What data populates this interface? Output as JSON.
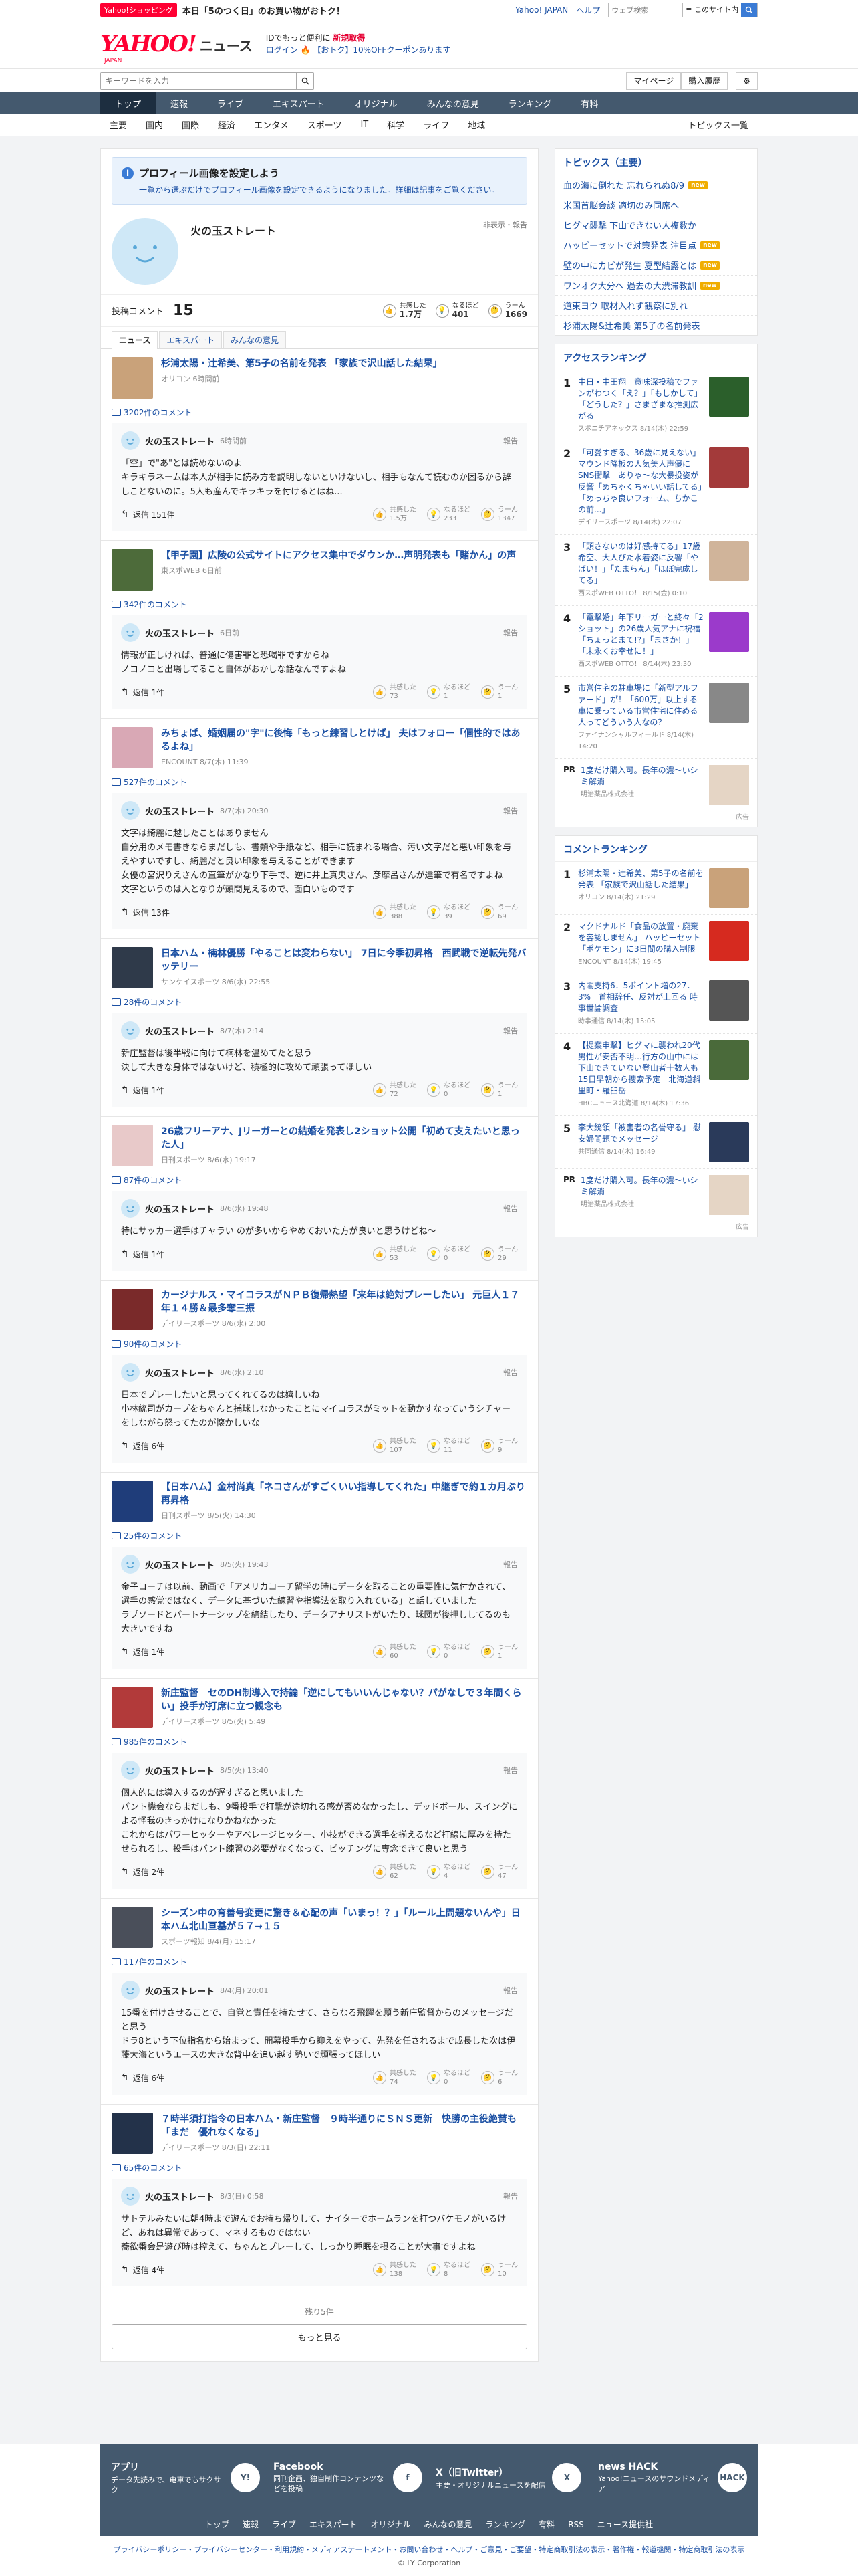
{
  "promo": {
    "shop": "Yahoo!ショッピング",
    "text": "本日「5のつく日」のお買い物がおトク！",
    "links": [
      "Yahoo! JAPAN",
      "ヘルプ"
    ],
    "search_placeholder": "ウェブ検索",
    "search_scope": "≡ このサイト内"
  },
  "header": {
    "logo": "YAHOO!",
    "logo_jp": "JAPAN",
    "logo_news": "ニュース",
    "msg1": "IDでもっと便利に",
    "msg1b": "新規取得",
    "login": "ログイン",
    "msg2": "【おトク】10%OFFクーポンあります"
  },
  "search": {
    "placeholder": "キーワードを入力",
    "mypage": "マイページ",
    "history": "購入履歴"
  },
  "nav": [
    "トップ",
    "速報",
    "ライブ",
    "エキスパート",
    "オリジナル",
    "みんなの意見",
    "ランキング",
    "有料"
  ],
  "subnav": [
    "主要",
    "国内",
    "国際",
    "経済",
    "エンタメ",
    "スポーツ",
    "IT",
    "科学",
    "ライフ",
    "地域"
  ],
  "subnav_right": "トピックス一覧",
  "notice": {
    "title": "プロフィール画像を設定しよう",
    "desc": "一覧から選ぶだけでプロフィール画像を設定できるようになりました。詳細は記事をご覧ください。"
  },
  "profile": {
    "name": "火の玉ストレート",
    "report": "非表示・報告"
  },
  "stats": {
    "label": "投稿コメント",
    "count": "15",
    "items": [
      {
        "l": "共感した",
        "v": "1.7万"
      },
      {
        "l": "なるほど",
        "v": "401"
      },
      {
        "l": "うーん",
        "v": "1669"
      }
    ]
  },
  "tabs": [
    "ニュース",
    "エキスパート",
    "みんなの意見"
  ],
  "items": [
    {
      "title": "杉浦太陽・辻希美、第5子の名前を発表 「家族で沢山話した結果」",
      "src": "オリコン 6時間前",
      "count": "3202件のコメント",
      "time": "6時間前",
      "body": "「空」で\"あ\"とは読めないのよ\nキラキラネームは本人が相手に読み方を説明しないといけないし、相手もなんて読むのか困るから辞しことないのに。5人も産んでキラキラを付けるとはね...",
      "reply": "返信 151件",
      "r": [
        "1.5万",
        "233",
        "1347"
      ],
      "col": "#c9a27a"
    },
    {
      "title": "【甲子園】広陵の公式サイトにアクセス集中でダウンか…声明発表も「賭かん」の声",
      "src": "東スポWEB 6日前",
      "count": "342件のコメント",
      "time": "6日前",
      "body": "情報が正しければ、普通に傷害罪と恐喝罪ですからね\nノコノコと出場してること自体がおかしな話なんですよね",
      "reply": "返信 1件",
      "r": [
        "73",
        "1",
        "1"
      ],
      "col": "#4d6b3a"
    },
    {
      "title": "みちょぱ、婚姻届の\"字\"に後悔「もっと練習しとけば」 夫はフォロー「個性的ではあるよね」",
      "src": "ENCOUNT 8/7(木) 11:39",
      "count": "527件のコメント",
      "time": "8/7(木) 20:30",
      "body": "文字は綺麗に越したことはありません\n自分用のメモ書きならまだしも、書類や手紙など、相手に読まれる場合、汚い文字だと悪い印象を与えやすいですし、綺麗だと良い印象を与えることができます\n女優の宮沢りえさんの直筆がかなり下手で、逆に井上真央さん、彦摩呂さんが達筆で有名ですよね\n文字というのは人となりが頭間見えるので、面白いものです",
      "reply": "返信 13件",
      "r": [
        "388",
        "39",
        "69"
      ],
      "col": "#d9a8b5"
    },
    {
      "title": "日本ハム・楠林優勝「やることは変わらない」 7日に今季初昇格　西武戦で逆転先発バッテリー",
      "src": "サンケイスポーツ 8/6(水) 22:55",
      "count": "28件のコメント",
      "time": "8/7(木) 2:14",
      "body": "新庄監督は後半戦に向けて楠林を温めてたと思う\n決して大きな身体ではないけど、積極的に攻めて頑張ってほしい",
      "reply": "返信 1件",
      "r": [
        "72",
        "0",
        "1"
      ],
      "col": "#2f3a4a"
    },
    {
      "title": "26歳フリーアナ、Jリーガーとの結婚を発表し2ショット公開「初めて支えたいと思った人」",
      "src": "日刊スポーツ 8/6(水) 19:17",
      "count": "87件のコメント",
      "time": "8/6(水) 19:48",
      "body": "特にサッカー選手はチャラい のが多いからやめておいた方が良いと思うけどね〜",
      "reply": "返信 1件",
      "r": [
        "53",
        "0",
        "29"
      ],
      "col": "#e8c9c9"
    },
    {
      "title": "カージナルス・マイコラスがＮＰＢ復帰熱望「来年は絶対プレーしたい」 元巨人１７年１４勝＆最多奪三振",
      "src": "デイリースポーツ 8/6(水) 2:00",
      "count": "90件のコメント",
      "time": "8/6(水) 2:10",
      "body": "日本でプレーしたいと思ってくれてるのは嬉しいね\n小林統司がカープをちゃんと捕球しなかったことにマイコラスがミットを動かすなっていうシチャーをしながら怒ってたのが懐かしいな",
      "reply": "返信 6件",
      "r": [
        "107",
        "11",
        "9"
      ],
      "col": "#7a2a2a"
    },
    {
      "title": "【日本ハム】金村尚真「ネコさんがすごくいい指導してくれた」中継ぎで約１カ月ぶり再昇格",
      "src": "日刊スポーツ 8/5(火) 14:30",
      "count": "25件のコメント",
      "time": "8/5(火) 19:43",
      "body": "金子コーチは以前、動画で「アメリカコーチ留学の時にデータを取ることの重要性に気付かされて、選手の感覚ではなく、データに基づいた練習や指導法を取り入れている」と話していました\nラプソードとパートナーシップを締結したり、データアナリストがいたり、球団が後押ししてるのも大きいですね",
      "reply": "返信 1件",
      "r": [
        "60",
        "0",
        "1"
      ],
      "col": "#1f3d7a"
    },
    {
      "title": "新庄監督　セのDH制導入で持論「逆にしてもいいんじゃない？パがなしで３年間くらい」投手が打席に立つ観念も",
      "src": "デイリースポーツ 8/5(火) 5:49",
      "count": "985件のコメント",
      "time": "8/5(火) 13:40",
      "body": "個人的には導入するのが遅すぎると思いました\nパント機会ならまだしも、9番投手で打撃が途切れる感が否めなかったし、デッドボール、スイングによる怪我のきっかけになりかねなかった\nこれからはパワーヒッターやアベレージヒッター、小技ができる選手を揃えるなど打線に厚みを持たせられるし、投手はバント練習の必要がなくなって、ピッチングに専念できて良いと思う",
      "reply": "返信 2件",
      "r": [
        "62",
        "4",
        "47"
      ],
      "col": "#b23a3a"
    },
    {
      "title": "シーズン中の育善号変更に驚き＆心配の声「いまっ！？」「ルール上問題ないんや」日本ハム北山亘基が５７→１５",
      "src": "スポーツ報知 8/4(月) 15:17",
      "count": "117件のコメント",
      "time": "8/4(月) 20:01",
      "body": "15番を付けさせることで、自覚と責任を持たせて、さらなる飛躍を願う新庄監督からのメッセージだと思う\nドラ8という下位指名から始まって、開幕投手から抑えをやって、先発を任されるまで成長した次は伊藤大海というエースの大きな背中を追い越す勢いで頑張ってほしい",
      "reply": "返信 6件",
      "r": [
        "74",
        "0",
        "6"
      ],
      "col": "#4a4f5a"
    },
    {
      "title": "７時半須打指令の日本ハム・新庄監督　９時半通りにＳＮＳ更新　快勝の主役絶賛も「まだ　優れなくなる」",
      "src": "デイリースポーツ 8/3(日) 22:11",
      "count": "65件のコメント",
      "time": "8/3(日) 0:58",
      "body": "サトテルみたいに朝4時まで遊んでお持ち帰りして、ナイターでホームランを打つバケモノがいるけど、あれは異常であって、マネするものではない\n蕎欲番会是遊び時は控えて、ちゃんとプレーして、しっかり睡眠を摂ることが大事ですよね",
      "reply": "返信 4件",
      "r": [
        "138",
        "8",
        "10"
      ],
      "col": "#23324a"
    }
  ],
  "more": {
    "remaining": "残り5件",
    "button": "もっと見る"
  },
  "side": {
    "topics_title": "トピックス（主要）",
    "topics": [
      {
        "t": "血の海に倒れた 忘れられぬ8/9",
        "b": "new"
      },
      {
        "t": "米国首脳会談 適切のみ同席へ",
        "b": ""
      },
      {
        "t": "ヒグマ襲撃 下山できない人複数か",
        "b": ""
      },
      {
        "t": "ハッピーセットで対策発表 注目点",
        "b": "new"
      },
      {
        "t": "壁の中にカビが発生 夏型結露とは",
        "b": "new"
      },
      {
        "t": "ワンオク大分へ 過去の大渋滞教訓",
        "b": "new"
      },
      {
        "t": "道東ヨウ 取材入れず観察に別れ",
        "b": ""
      },
      {
        "t": "杉浦太陽&辻希美 第5子の名前発表",
        "b": ""
      }
    ],
    "access_title": "アクセスランキング",
    "access": [
      {
        "t": "中日・中田翔　意味深投稿でファンがわつく「え？」「もしかして」「どうした？」さまざまな推測広がる",
        "s": "スポニチアネックス 8/14(木) 22:59",
        "c": "#2b5f2b"
      },
      {
        "t": "「可愛すぎる、36歳に見えない」マウンド降板の人気美人声優にSNS衝撃　ありゃ〜な大暴投姿が反響「めちゃくちゃいい話してる」「めっちゃ良いフォーム、ちかこの前...」",
        "s": "デイリースポーツ 8/14(木) 22:07",
        "c": "#a33a3a"
      },
      {
        "t": "「頭さないのは好感持てる」17歳希空、大人びた水着姿に反響「やばい！」「たまらん」「ほぼ完成してる」",
        "s": "西スポWEB OTTO！ 8/15(金) 0:10",
        "c": "#d0b49a"
      },
      {
        "t": "「電撃婚」年下リーガーと終々「2ショット」の26歳人気アナに祝福「ちょっとまて!?」「まさか！」「末永くお幸せに！」",
        "s": "西スポWEB OTTO！ 8/14(木) 23:30",
        "c": "#9b3acb"
      },
      {
        "t": "市営住宅の駐車場に「新型アルファード」が！「600万」以上する車に乗っている市営住宅に住める人ってどういう人なの？",
        "s": "ファイナンシャルフィールド 8/14(木) 14:20",
        "c": "#888"
      }
    ],
    "pr1": {
      "t": "1度だけ購入可。長年の濃〜いシミ解消",
      "s": "明治薬品株式会社"
    },
    "ad_label": "広告",
    "comment_title": "コメントランキング",
    "comment": [
      {
        "t": "杉浦太陽・辻希美、第5子の名前を発表 「家族で沢山話した結果」",
        "s": "オリコン 8/14(木) 21:29",
        "c": "#c9a27a"
      },
      {
        "t": "マクドナルド「食品の放置・廃棄を容認しません」 ハッピーセット「ポケモン」に3日間の購入制限",
        "s": "ENCOUNT 8/14(木) 19:45",
        "c": "#d62a1f"
      },
      {
        "t": "内閣支持6．5ポイント増の27．3%　首相辞任、反対が上回る 時事世論調査",
        "s": "時事通信 8/14(木) 15:05",
        "c": "#555"
      },
      {
        "t": "【提案申撃】ヒグマに襲われ20代男性が安否不明…行方の山中には下山できていない登山者十数人も 15日早朝から捜索予定　北海道斜里町・羅臼岳",
        "s": "HBCニュース北海道 8/14(木) 17:36",
        "c": "#4a6a3a"
      },
      {
        "t": "李大統領「被害者の名誉守る」 慰安婦問題でメッセージ",
        "s": "共同通信 8/14(木) 16:49",
        "c": "#2a3a5a"
      }
    ],
    "pr2": {
      "t": "1度だけ購入可。長年の濃〜いシミ解消",
      "s": "明治薬品株式会社"
    }
  },
  "footer": {
    "apps": [
      {
        "t": "アプリ",
        "d": "データ先読みで、电車でもサクサク",
        "ic": "Y!"
      },
      {
        "t": "Facebook",
        "d": "同刊企画、独自制作コンテンツなどを投稿",
        "ic": "f"
      },
      {
        "t": "X（旧Twitter）",
        "d": "主要・オリジナルニュースを配信",
        "ic": "X"
      },
      {
        "t": "news HACK",
        "d": "Yahoo!ニュースのサウンドメディア",
        "ic": "HACK"
      }
    ],
    "nav": [
      "トップ",
      "速報",
      "ライブ",
      "エキスパート",
      "オリジナル",
      "みんなの意見",
      "ランキング",
      "有料",
      "RSS",
      "ニュース提供社"
    ],
    "links": "プライバシーポリシー・プライバシーセンター・利用規約・メディアステートメント・お問い合わせ・ヘルプ・ご意見・ご要望・特定商取引法の表示・著作権・報道機関・特定商取引法の表示",
    "copy": "© LY Corporation"
  },
  "colors": {
    "brand": "#ff0033",
    "nav": "#44596e",
    "link": "#1a4fa3"
  }
}
